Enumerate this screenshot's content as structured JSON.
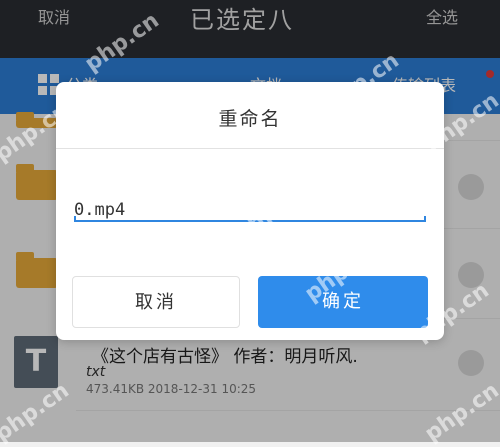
{
  "top_bar": {
    "cancel_label": "取消",
    "title": "已选定八",
    "select_all_label": "全选"
  },
  "tab_bar": {
    "tab_1": "分类",
    "tab_2": "文档",
    "tab_3": "传输列表",
    "notification_color": "#e23b3b"
  },
  "file_item": {
    "icon_letter": "T",
    "title": "《这个店有古怪》 作者：明月听风.",
    "extension": "txt",
    "meta": "473.41KB  2018-12-31  10:25"
  },
  "rename_dialog": {
    "title": "重命名",
    "input_value": "0.mp4",
    "cancel_label": "取消",
    "confirm_label": "确定"
  },
  "watermark_text": "php.cn",
  "colors": {
    "accent": "#2f8ceb",
    "tab_bar": "#2c7dd6",
    "top_bar": "#2a2d33",
    "folder": "#e6a93a"
  }
}
